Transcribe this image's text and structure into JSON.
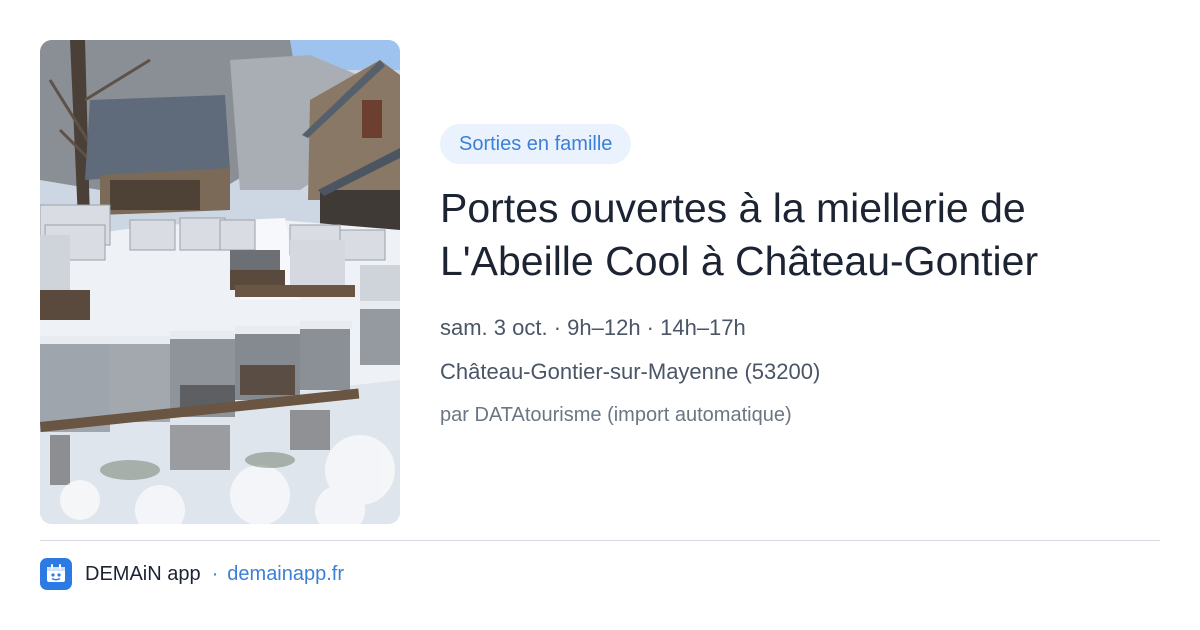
{
  "card": {
    "image_alt": "Ruches enneigées devant la miellerie",
    "category": "Sorties en famille",
    "title_lines": [
      "Portes ouvertes à la miellerie de",
      "L'Abeille Cool à Château-Gontier"
    ],
    "date_time": "sam. 3 oct. · 9h–12h · 14h–17h",
    "location": "Château-Gontier-sur-Mayenne (53200)",
    "author": "par DATAtourisme (import automatique)"
  },
  "footer": {
    "logo_icon": "demain-app-logo-icon",
    "app_name": "DEMAiN app",
    "separator": "·",
    "domain": "demainapp.fr"
  },
  "colors": {
    "accent": "#3d7fd6",
    "badge_bg": "#eaf2fd",
    "title": "#1c2433",
    "meta": "#4a5566",
    "logo_bg": "#2c7be5"
  }
}
